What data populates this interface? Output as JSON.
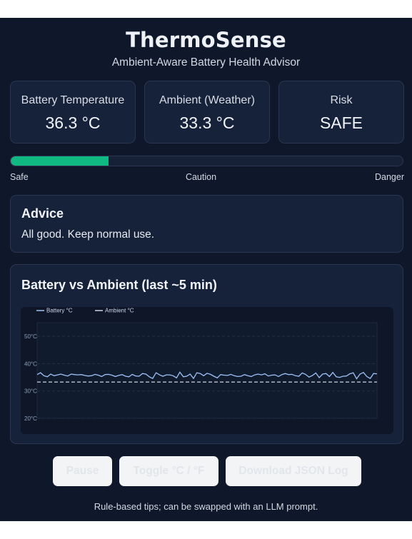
{
  "app": {
    "title": "ThermoSense",
    "subtitle": "Ambient-Aware Battery Health Advisor"
  },
  "metrics": [
    {
      "label": "Battery Temperature",
      "value": "36.3 °C"
    },
    {
      "label": "Ambient (Weather)",
      "value": "33.3 °C"
    },
    {
      "label": "Risk",
      "value": "SAFE"
    }
  ],
  "risk_meter": {
    "level_fraction": 0.25,
    "fill_color": "#10b981",
    "labels": [
      "Safe",
      "Caution",
      "Danger"
    ]
  },
  "advice": {
    "title": "Advice",
    "text": "All good. Keep normal use."
  },
  "chart_data": {
    "type": "line",
    "title": "Battery vs Ambient (last ~5 min)",
    "xlabel": "",
    "ylabel": "",
    "ylim": [
      20,
      55
    ],
    "yticks": [
      "20°C",
      "30°C",
      "40°C",
      "50°C"
    ],
    "ytick_values": [
      20,
      30,
      40,
      50
    ],
    "grid": true,
    "legend_position": "top-left",
    "series": [
      {
        "name": "Battery °C",
        "color": "#9fc1f7",
        "style": "solid",
        "values": [
          36.0,
          36.7,
          35.6,
          35.2,
          36.2,
          35.6,
          35.9,
          36.2,
          35.8,
          35.5,
          36.2,
          36.0,
          35.9,
          36.0,
          35.7,
          35.5,
          35.6,
          36.1,
          35.8,
          35.3,
          36.0,
          36.1,
          35.8,
          35.3,
          35.7,
          36.0,
          35.4,
          35.2,
          36.1,
          35.5,
          35.4,
          36.4,
          36.2,
          35.2,
          34.6,
          36.7,
          35.9,
          35.4,
          35.9,
          35.9,
          35.6,
          34.8,
          36.9,
          35.2,
          35.4,
          36.2,
          34.6,
          36.7,
          36.4,
          35.6,
          36.5,
          36.1,
          35.4,
          34.8,
          36.0,
          35.8,
          35.7,
          36.1,
          35.6,
          35.3,
          35.4,
          36.0,
          35.6,
          35.3,
          35.9,
          36.2,
          35.9,
          36.3,
          35.5,
          35.8,
          35.9,
          35.3,
          36.0,
          36.4,
          36.0,
          36.1,
          35.6,
          35.4,
          36.6,
          36.1,
          35.1,
          35.7,
          36.6,
          34.9,
          36.2,
          36.4,
          35.3,
          36.8,
          35.2,
          35.0,
          35.4,
          35.5,
          36.3,
          36.7,
          34.5,
          36.2,
          36.8,
          35.3,
          34.6,
          36.4,
          36.3
        ]
      },
      {
        "name": "Ambient °C",
        "color": "#cbd5e1",
        "style": "dashed",
        "values": [
          33.3,
          33.3,
          33.3,
          33.3,
          33.3,
          33.3,
          33.3,
          33.3,
          33.3,
          33.3,
          33.3,
          33.3,
          33.3,
          33.3,
          33.3,
          33.3,
          33.3,
          33.3,
          33.3,
          33.3,
          33.3,
          33.3,
          33.3,
          33.3,
          33.3,
          33.3,
          33.3,
          33.3,
          33.3,
          33.3,
          33.3,
          33.3,
          33.3,
          33.3,
          33.3,
          33.3,
          33.3,
          33.3,
          33.3,
          33.3,
          33.3,
          33.3,
          33.3,
          33.3,
          33.3,
          33.3,
          33.3,
          33.3,
          33.3,
          33.3,
          33.3,
          33.3,
          33.3,
          33.3,
          33.3,
          33.3,
          33.3,
          33.3,
          33.3,
          33.3,
          33.3,
          33.3,
          33.3,
          33.3,
          33.3,
          33.3,
          33.3,
          33.3,
          33.3,
          33.3,
          33.3,
          33.3,
          33.3,
          33.3,
          33.3,
          33.3,
          33.3,
          33.3,
          33.3,
          33.3,
          33.3,
          33.3,
          33.3,
          33.3,
          33.3,
          33.3,
          33.3,
          33.3,
          33.3,
          33.3,
          33.3,
          33.3,
          33.3,
          33.3,
          33.3,
          33.3,
          33.3,
          33.3,
          33.3,
          33.3,
          33.3
        ]
      }
    ]
  },
  "buttons": {
    "pause": "Pause",
    "toggle_units": "Toggle °C / °F",
    "download": "Download JSON Log"
  },
  "footer": "Rule-based tips; can be swapped with an LLM prompt."
}
